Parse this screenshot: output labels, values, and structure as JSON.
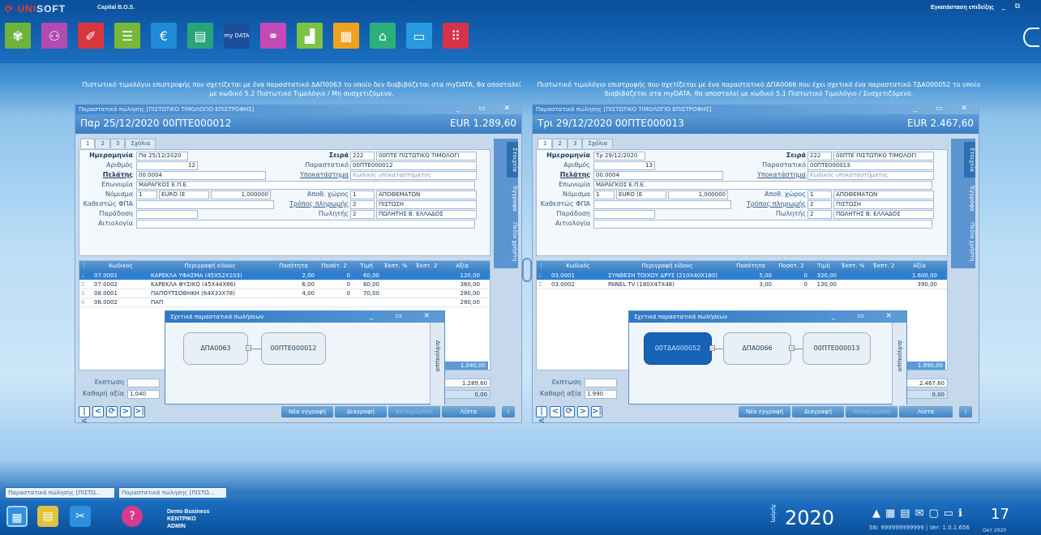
{
  "app": {
    "logo_a": "UNI",
    "logo_b": "SOFT",
    "subtitle": "Capital B.O.S.",
    "install": "Εγκατάσταση επιδείξης"
  },
  "toolbar": {
    "icons": [
      "people-icon",
      "family-icon",
      "tag-icon",
      "document-icon",
      "euro-icon",
      "ledger-icon",
      "mydata-icon",
      "handshake-icon",
      "chart-icon",
      "calculator-icon",
      "network-icon",
      "screen-icon",
      "numbers-icon"
    ],
    "mydata_text": "my DATA"
  },
  "notes": {
    "left": "Πιστωτικό τιμολόγιο επιστροφής που σχετίζεται με ένα παραστατικό ΔΑΠ0063 το οποίο δεν διαβιβάζεται στα myDATA, θα αποσταλεί με κωδικό 5.2 Πιστωτικό Τιμολόγιο / Μη συσχετιζόμενο.",
    "right": "Πιστωτικό τιμολόγιο επιστροφής που σχετίζεται με ένα παραστατικό ΔΠΑ0066 που έχει σχετικό ένα παραστατικό ΤΔΑ000052 το οποίο διαβιβάζεται στα myDATA, θα αποσταλεί με κωδικό 5.1 Πιστωτικό Τιμολόγιο / Συσχετιζόμενο."
  },
  "labels": {
    "date": "Ημερομηνία",
    "number": "Αριθμός",
    "customer": "Πελάτης",
    "name": "Επωνυμία",
    "currency": "Νόμισμα",
    "vat": "Καθεστώς ΦΠΑ",
    "delivery": "Παράδοση",
    "reason": "Αιτιολογία",
    "series": "Σειρά",
    "doc": "Παραστατικό",
    "branch": "Υποκατάστημα",
    "warehouse": "Αποθ. χώρος",
    "payment": "Τρόπος πληρωμής",
    "seller": "Πωλητής",
    "tab1": "1",
    "tab2": "2",
    "tab3": "3",
    "tab4": "Σχόλια",
    "side1": "Στοιχεία",
    "side2": "Έγγραφα",
    "side3": "Πεδία χρήστη",
    "discount": "Εκπτωση",
    "net": "Καθαρή αξία",
    "related_title": "Σχετικά παραστατικά πωλήσεων",
    "related_side": "Διάγραμμα",
    "new": "Νέα εγγραφή",
    "delete": "Διαγραφή",
    "post": "Καταχώρηση",
    "list": "Λίστα"
  },
  "columns": [
    "Κωδικός",
    "Περιγραφή είδους",
    "Ποσότητα",
    "Ποσότ. 2",
    "Τιμή",
    "Έκπτ. %",
    "Έκπτ. 2",
    "Αξία"
  ],
  "windows": [
    {
      "title": "Παραστατικά πώλησης [ΠΙΣΤΩΤΙΚΟ ΤΙΜΟΛΟΓΙΟ ΕΠΙΣΤΡΟΦΗΣ]",
      "header": "Παρ 25/12/2020 00ΠΤΕ000012",
      "amount": "EUR 1.289,60",
      "date": "Πα 25/12/2020",
      "number": "12",
      "customer": "00.0004",
      "name": "ΜΑΡΑΓΚΟΣ Ε.Π.Ε.",
      "currency_code": "1",
      "currency": "EURO (E",
      "rate": "1,000000",
      "series_code": "222",
      "series": "00ΠΤΕ ΠΙΣΤΩΤΙΚΟ ΤΙΜΟΛΟΓΙ",
      "doc": "00ΠΤΕ000012",
      "branch": "Κωδικός υποκαταστήματος",
      "wh_code": "1",
      "wh": "ΑΠΟΘΕΜΑΤΩΝ",
      "pay_code": "2",
      "pay": "ΠΙΣΤΩΣΗ",
      "seller_code": "2",
      "seller": "ΠΩΛΗΤΗΣ Β. ΕΛΛΑΔΟΣ",
      "rows": [
        {
          "n": "1",
          "code": "07.0001",
          "desc": "ΚΑΡΕΚΛΑ ΥΦΑΣΜΑ (45Χ52Χ103)",
          "qty": "2,00",
          "q2": "0",
          "price": "60,00",
          "value": "120,00"
        },
        {
          "n": "2",
          "code": "07.0002",
          "desc": "ΚΑΡΕΚΛΑ ΦΥΣΙΚΟ (45Χ44Χ86)",
          "qty": "6,00",
          "q2": "0",
          "price": "60,00",
          "value": "360,00"
        },
        {
          "n": "3",
          "code": "08.0001",
          "desc": "ΠΑΠΟΥΤΣΟΘΗΚΗ (64Χ33Χ78)",
          "qty": "4,00",
          "q2": "0",
          "price": "70,00",
          "value": "280,00"
        },
        {
          "n": "4",
          "code": "08.0002",
          "desc": "ΠΑΠ",
          "qty": "",
          "q2": "",
          "price": "",
          "value": "280,00"
        }
      ],
      "sum": "1.040,00",
      "discount_total": "1.289,60",
      "net": "1,040",
      "net_val": "0,00",
      "nodes": [
        "ΔΠΑ0063",
        "00ΠΤΕ000012"
      ]
    },
    {
      "title": "Παραστατικά πώλησης [ΠΙΣΤΩΤΙΚΟ ΤΙΜΟΛΟΓΙΟ ΕΠΙΣΤΡΟΦΗΣ]",
      "header": "Τρι 29/12/2020 00ΠΤΕ000013",
      "amount": "EUR 2.467,60",
      "date": "Τρ 29/12/2020",
      "number": "13",
      "customer": "00.0004",
      "name": "ΜΑΡΑΓΚΟΣ Ε.Π.Ε.",
      "currency_code": "1",
      "currency": "EURO (E",
      "rate": "1,000000",
      "series_code": "222",
      "series": "00ΠΤΕ ΠΙΣΤΩΤΙΚΟ ΤΙΜΟΛΟΓΙ",
      "doc": "00ΠΤΕ000013",
      "branch": "Κωδικός υποκαταστήματος",
      "wh_code": "1",
      "wh": "ΑΠΟΘΕΜΑΤΩΝ",
      "pay_code": "2",
      "pay": "ΠΙΣΤΩΣΗ",
      "seller_code": "2",
      "seller": "ΠΩΛΗΤΗΣ Β. ΕΛΛΑΔΟΣ",
      "rows": [
        {
          "n": "1",
          "code": "03.0001",
          "desc": "ΣΥΝΘΕΣΗ ΤΟΙΧΟΥ ΔΡΥΣ (210Χ40Χ180)",
          "qty": "5,00",
          "q2": "0",
          "price": "320,00",
          "value": "1.600,00"
        },
        {
          "n": "2",
          "code": "03.0002",
          "desc": "PANEL TV (180Χ47Χ48)",
          "qty": "3,00",
          "q2": "0",
          "price": "130,00",
          "value": "390,00"
        }
      ],
      "sum": "1.990,00",
      "discount_total": "2.467,60",
      "net": "1.990",
      "net_val": "0,00",
      "nodes": [
        "00ΤΔΑ000052",
        "ΔΠΑ0066",
        "00ΠΤΕ000013"
      ]
    }
  ],
  "taskbar": [
    "Παραστατικά πώλησης [ΠΙΣΤΩ...",
    "Παραστατικά πώλησης [ΠΙΣΤΩ..."
  ],
  "bottom": {
    "company": "Demo Business",
    "branch": "ΚΕΝΤΡΙΚΟ",
    "user": "ADMIN",
    "use_label": "Χρήση",
    "year": "2020",
    "day": "17",
    "month": "Οκτ 2020",
    "sn": "SN: 999999999999 | Ver: 1.0.1.656"
  }
}
